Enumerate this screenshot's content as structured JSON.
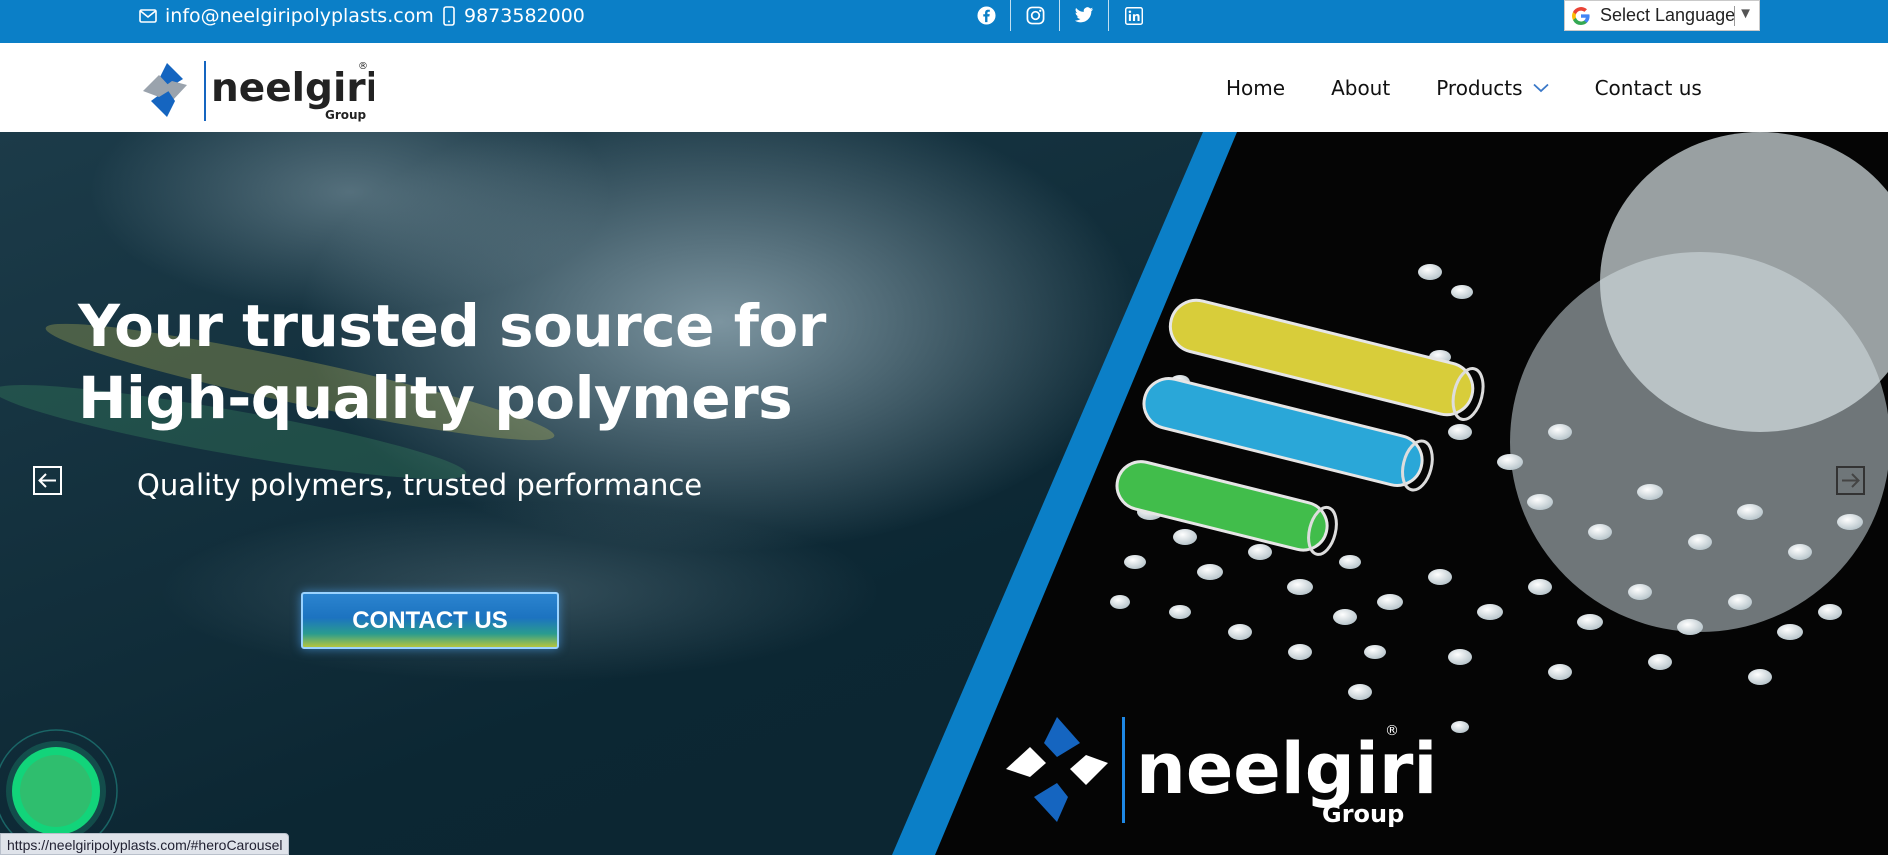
{
  "topbar": {
    "email": "info@neelgiripolyplasts.com",
    "phone": "9873582000",
    "social_icons": [
      "facebook-icon",
      "instagram-icon",
      "twitter-icon",
      "linkedin-icon"
    ],
    "language_selector": "Select Language",
    "background_color": "#0b7fc7"
  },
  "brand": {
    "name": "neelgiri",
    "subtitle": "Group",
    "registered_mark": "®",
    "accent_color": "#1565c0"
  },
  "nav": {
    "items": [
      "Home",
      "About",
      "Products",
      "Contact us"
    ]
  },
  "hero": {
    "headline_line1": "Your trusted source for",
    "headline_line2": "High-quality polymers",
    "tagline": "Quality polymers, trusted performance",
    "cta_label": "CONTACT US",
    "prev_icon": "arrow-left-icon",
    "next_icon": "arrow-right-icon"
  },
  "status_bar": {
    "url": "https://neelgiripolyplasts.com/#heroCarousel"
  }
}
